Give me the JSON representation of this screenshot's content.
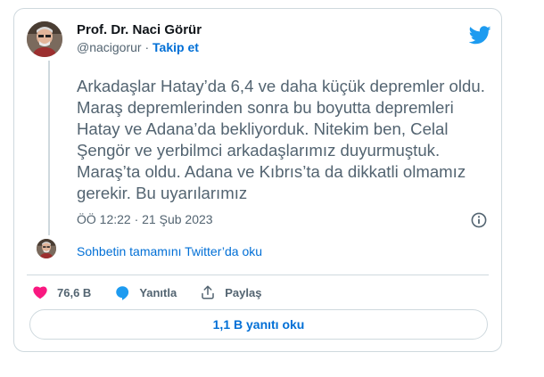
{
  "author": {
    "name": "Prof. Dr. Naci Görür",
    "handle": "@nacigorur",
    "separator": " · ",
    "follow_label": "Takip et"
  },
  "tweet": {
    "text": "Arkadaşlar Hatay’da 6,4 ve daha küçük depremler oldu. Maraş depremlerinden sonra bu boyutta depremleri Hatay ve Adana’da bekliyorduk. Nitekim ben, Celal Şengör ve yerbilmci arkadaşlarımız duyurmuştuk. Maraş’ta oldu. Adana ve Kıbrıs’ta da dikkatli olmamız gerekir. Bu uyarılarımız",
    "timestamp": "ÖÖ 12:22 · 21 Şub 2023"
  },
  "thread": {
    "read_label": "Sohbetin tamamını Twitter’da oku"
  },
  "actions": {
    "like_count": "76,6 B",
    "reply_label": "Yanıtla",
    "share_label": "Paylaş"
  },
  "replies_button_label": "1,1 B yanıtı oku",
  "colors": {
    "link": "#006fd6",
    "twitter_blue": "#1d9bf0",
    "like": "#f91880",
    "secondary_text": "#536471",
    "border": "#cfd9de"
  },
  "icons": [
    "avatar",
    "twitter-bird-icon",
    "info-icon",
    "heart-icon",
    "reply-bubble-icon",
    "share-icon"
  ]
}
